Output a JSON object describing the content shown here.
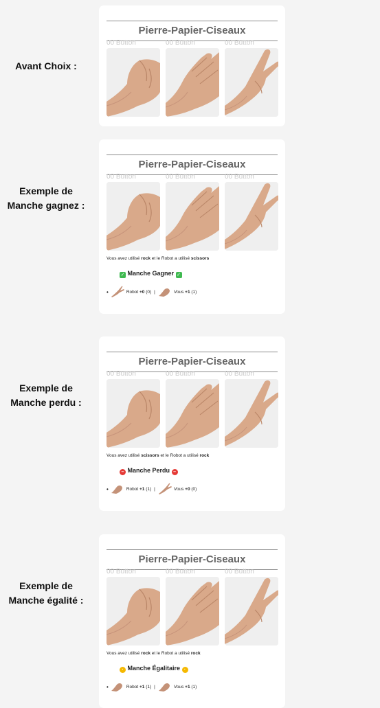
{
  "app_title": "Pierre-Papier-Ciseaux",
  "button_label": "00 Button",
  "rows": [
    {
      "label_lines": [
        "Avant Choix :"
      ],
      "has_result": false
    },
    {
      "label_lines": [
        "Exemple de",
        "Manche gagnez :"
      ],
      "has_result": true,
      "summary": {
        "prefix": "Vous avez utilisé",
        "user_choice": "rock",
        "middle": "et le Robot a utilisé",
        "robot_choice": "scissors"
      },
      "verdict": {
        "text": "Manche Gagner",
        "emoji": "check"
      },
      "score": {
        "robot_label": "Robot",
        "robot_delta": "+0",
        "robot_total": "(0)",
        "sep": "|",
        "user_label": "Vous",
        "user_delta": "+1",
        "user_total": "(1)",
        "robot_hand": "scissors",
        "user_hand": "rock"
      }
    },
    {
      "label_lines": [
        "Exemple de",
        "Manche perdu :"
      ],
      "has_result": true,
      "summary": {
        "prefix": "Vous avez utilisé",
        "user_choice": "scissors",
        "middle": "et le Robot a utilisé",
        "robot_choice": "rock"
      },
      "verdict": {
        "text": "Manche Perdu",
        "emoji": "stop"
      },
      "score": {
        "robot_label": "Robot",
        "robot_delta": "+1",
        "robot_total": "(1)",
        "sep": "|",
        "user_label": "Vous",
        "user_delta": "+0",
        "user_total": "(0)",
        "robot_hand": "rock",
        "user_hand": "scissors"
      }
    },
    {
      "label_lines": [
        "Exemple de",
        "Manche égalité :"
      ],
      "has_result": true,
      "summary": {
        "prefix": "Vous avez utilisé",
        "user_choice": "rock",
        "middle": "et le Robot a utilisé",
        "robot_choice": "rock"
      },
      "verdict": {
        "text": "Manche Égalitaire",
        "emoji": "shake"
      },
      "score": {
        "robot_label": "Robot",
        "robot_delta": "+1",
        "robot_total": "(1)",
        "sep": "|",
        "user_label": "Vous",
        "user_delta": "+1",
        "user_total": "(1)",
        "robot_hand": "rock",
        "user_hand": "rock"
      }
    }
  ],
  "choices": [
    {
      "name": "rock",
      "icon": "rock-hand-icon"
    },
    {
      "name": "paper",
      "icon": "paper-hand-icon"
    },
    {
      "name": "scissors",
      "icon": "scissors-hand-icon"
    }
  ],
  "colors": {
    "skin": "#d9a98a",
    "skin_dark": "#b98567",
    "tile": "#efefef"
  }
}
